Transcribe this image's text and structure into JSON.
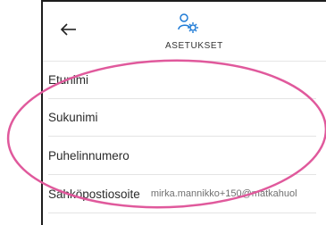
{
  "header": {
    "title": "ASETUKSET",
    "back_icon": "arrow-left-icon",
    "settings_icon": "user-gear-icon"
  },
  "fields": [
    {
      "label": "Etunimi",
      "value": ""
    },
    {
      "label": "Sukunimi",
      "value": ""
    },
    {
      "label": "Puhelinnumero",
      "value": ""
    },
    {
      "label": "Sähköpostiosoite",
      "value": "mirka.mannikko+150@matkahuol"
    }
  ],
  "colors": {
    "annotation": "#e0599c",
    "accent": "#1f7bd6"
  }
}
